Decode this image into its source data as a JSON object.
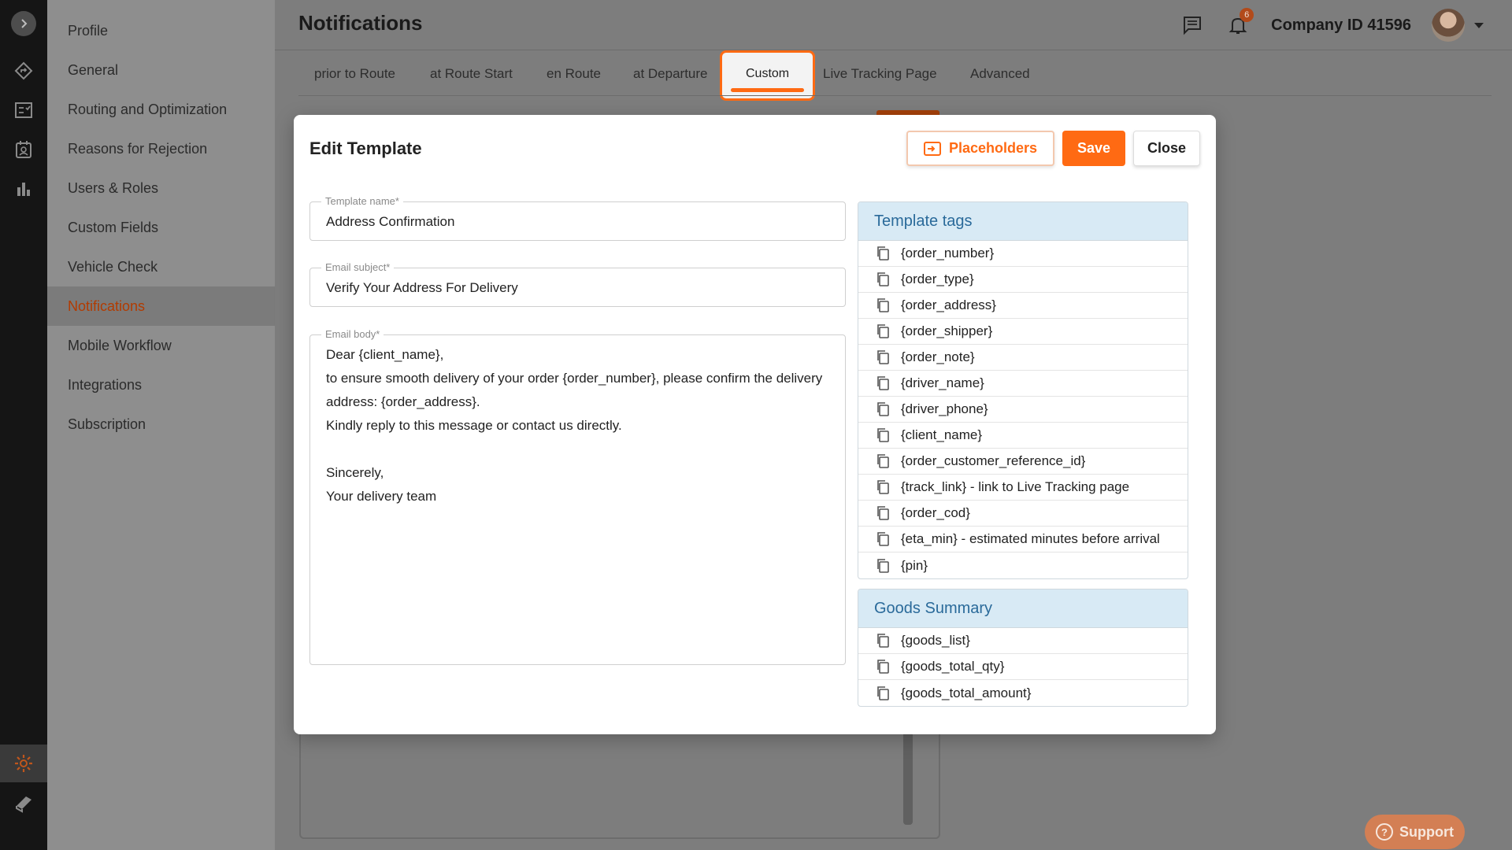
{
  "settings_nav": {
    "items": [
      {
        "label": "Profile",
        "active": false
      },
      {
        "label": "General",
        "active": false
      },
      {
        "label": "Routing and Optimization",
        "active": false
      },
      {
        "label": "Reasons for Rejection",
        "active": false
      },
      {
        "label": "Users & Roles",
        "active": false
      },
      {
        "label": "Custom Fields",
        "active": false
      },
      {
        "label": "Vehicle Check",
        "active": false
      },
      {
        "label": "Notifications",
        "active": true
      },
      {
        "label": "Mobile Workflow",
        "active": false
      },
      {
        "label": "Integrations",
        "active": false
      },
      {
        "label": "Subscription",
        "active": false
      }
    ]
  },
  "header": {
    "title": "Notifications",
    "notification_count": "6",
    "company": "Company ID 41596"
  },
  "tabs": [
    {
      "label": "prior to Route"
    },
    {
      "label": "at Route Start"
    },
    {
      "label": "en Route"
    },
    {
      "label": "at Departure"
    },
    {
      "label": "Custom",
      "active": true
    },
    {
      "label": "Live Tracking Page"
    },
    {
      "label": "Advanced"
    }
  ],
  "modal": {
    "title": "Edit Template",
    "placeholders_label": "Placeholders",
    "save_label": "Save",
    "close_label": "Close",
    "template_name": {
      "label": "Template name*",
      "value": "Address Confirmation"
    },
    "email_subject": {
      "label": "Email subject*",
      "value": "Verify Your Address For Delivery"
    },
    "email_body": {
      "label": "Email body*",
      "value": "Dear {client_name},\nto ensure smooth delivery of your order {order_number}, please confirm the delivery address: {order_address}.\nKindly reply to this message or contact us directly.\n\nSincerely,\nYour delivery team"
    },
    "template_tags": {
      "title": "Template tags",
      "items": [
        "{order_number}",
        "{order_type}",
        "{order_address}",
        "{order_shipper}",
        "{order_note}",
        "{driver_name}",
        "{driver_phone}",
        "{client_name}",
        "{order_customer_reference_id}",
        "{track_link} - link to Live Tracking page",
        "{order_cod}",
        "{eta_min} - estimated minutes before arrival",
        "{pin}"
      ]
    },
    "goods_summary": {
      "title": "Goods Summary",
      "items": [
        "{goods_list}",
        "{goods_total_qty}",
        "{goods_total_amount}"
      ]
    }
  },
  "support_label": "Support",
  "colors": {
    "accent": "#ff6a13",
    "tag_header_bg": "#d8eaf5",
    "tag_header_text": "#2a6a9a"
  }
}
